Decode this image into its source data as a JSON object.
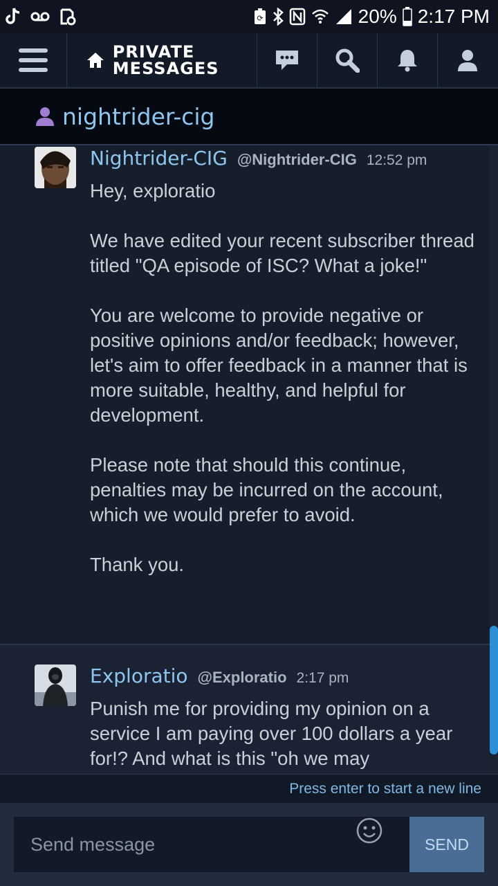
{
  "status_bar": {
    "battery_percent": "20%",
    "time": "2:17 PM"
  },
  "nav": {
    "title": "PRIVATE MESSAGES"
  },
  "conversation": {
    "name": "nightrider-cig"
  },
  "messages": [
    {
      "author": "Nightrider-CIG",
      "handle": "@Nightrider-CIG",
      "time": "12:52 pm",
      "paragraphs": [
        "Hey, exploratio",
        "We have edited your recent subscriber thread titled \"QA episode of ISC? What a joke!\"",
        "You are welcome to provide negative or positive opinions and/or feedback; however, let's aim to offer feedback in a manner that is more suitable, healthy, and helpful for development.",
        "Please note that should this continue, penalties may be incurred on the account, which we would prefer to avoid.",
        "Thank you."
      ]
    },
    {
      "author": "Exploratio",
      "handle": "@Exploratio",
      "time": "2:17 pm",
      "paragraphs": [
        "Punish me for providing my opinion on a service I am paying over 100 dollars a year for!? And what is this \"oh we may"
      ]
    }
  ],
  "composer": {
    "hint": "Press enter to start a new line",
    "placeholder": "Send message",
    "send_label": "SEND"
  },
  "colors": {
    "accent": "#8ec6ee",
    "background": "#161e2c",
    "send_button": "#4a6d96",
    "scroll_thumb": "#2f8fd6"
  }
}
